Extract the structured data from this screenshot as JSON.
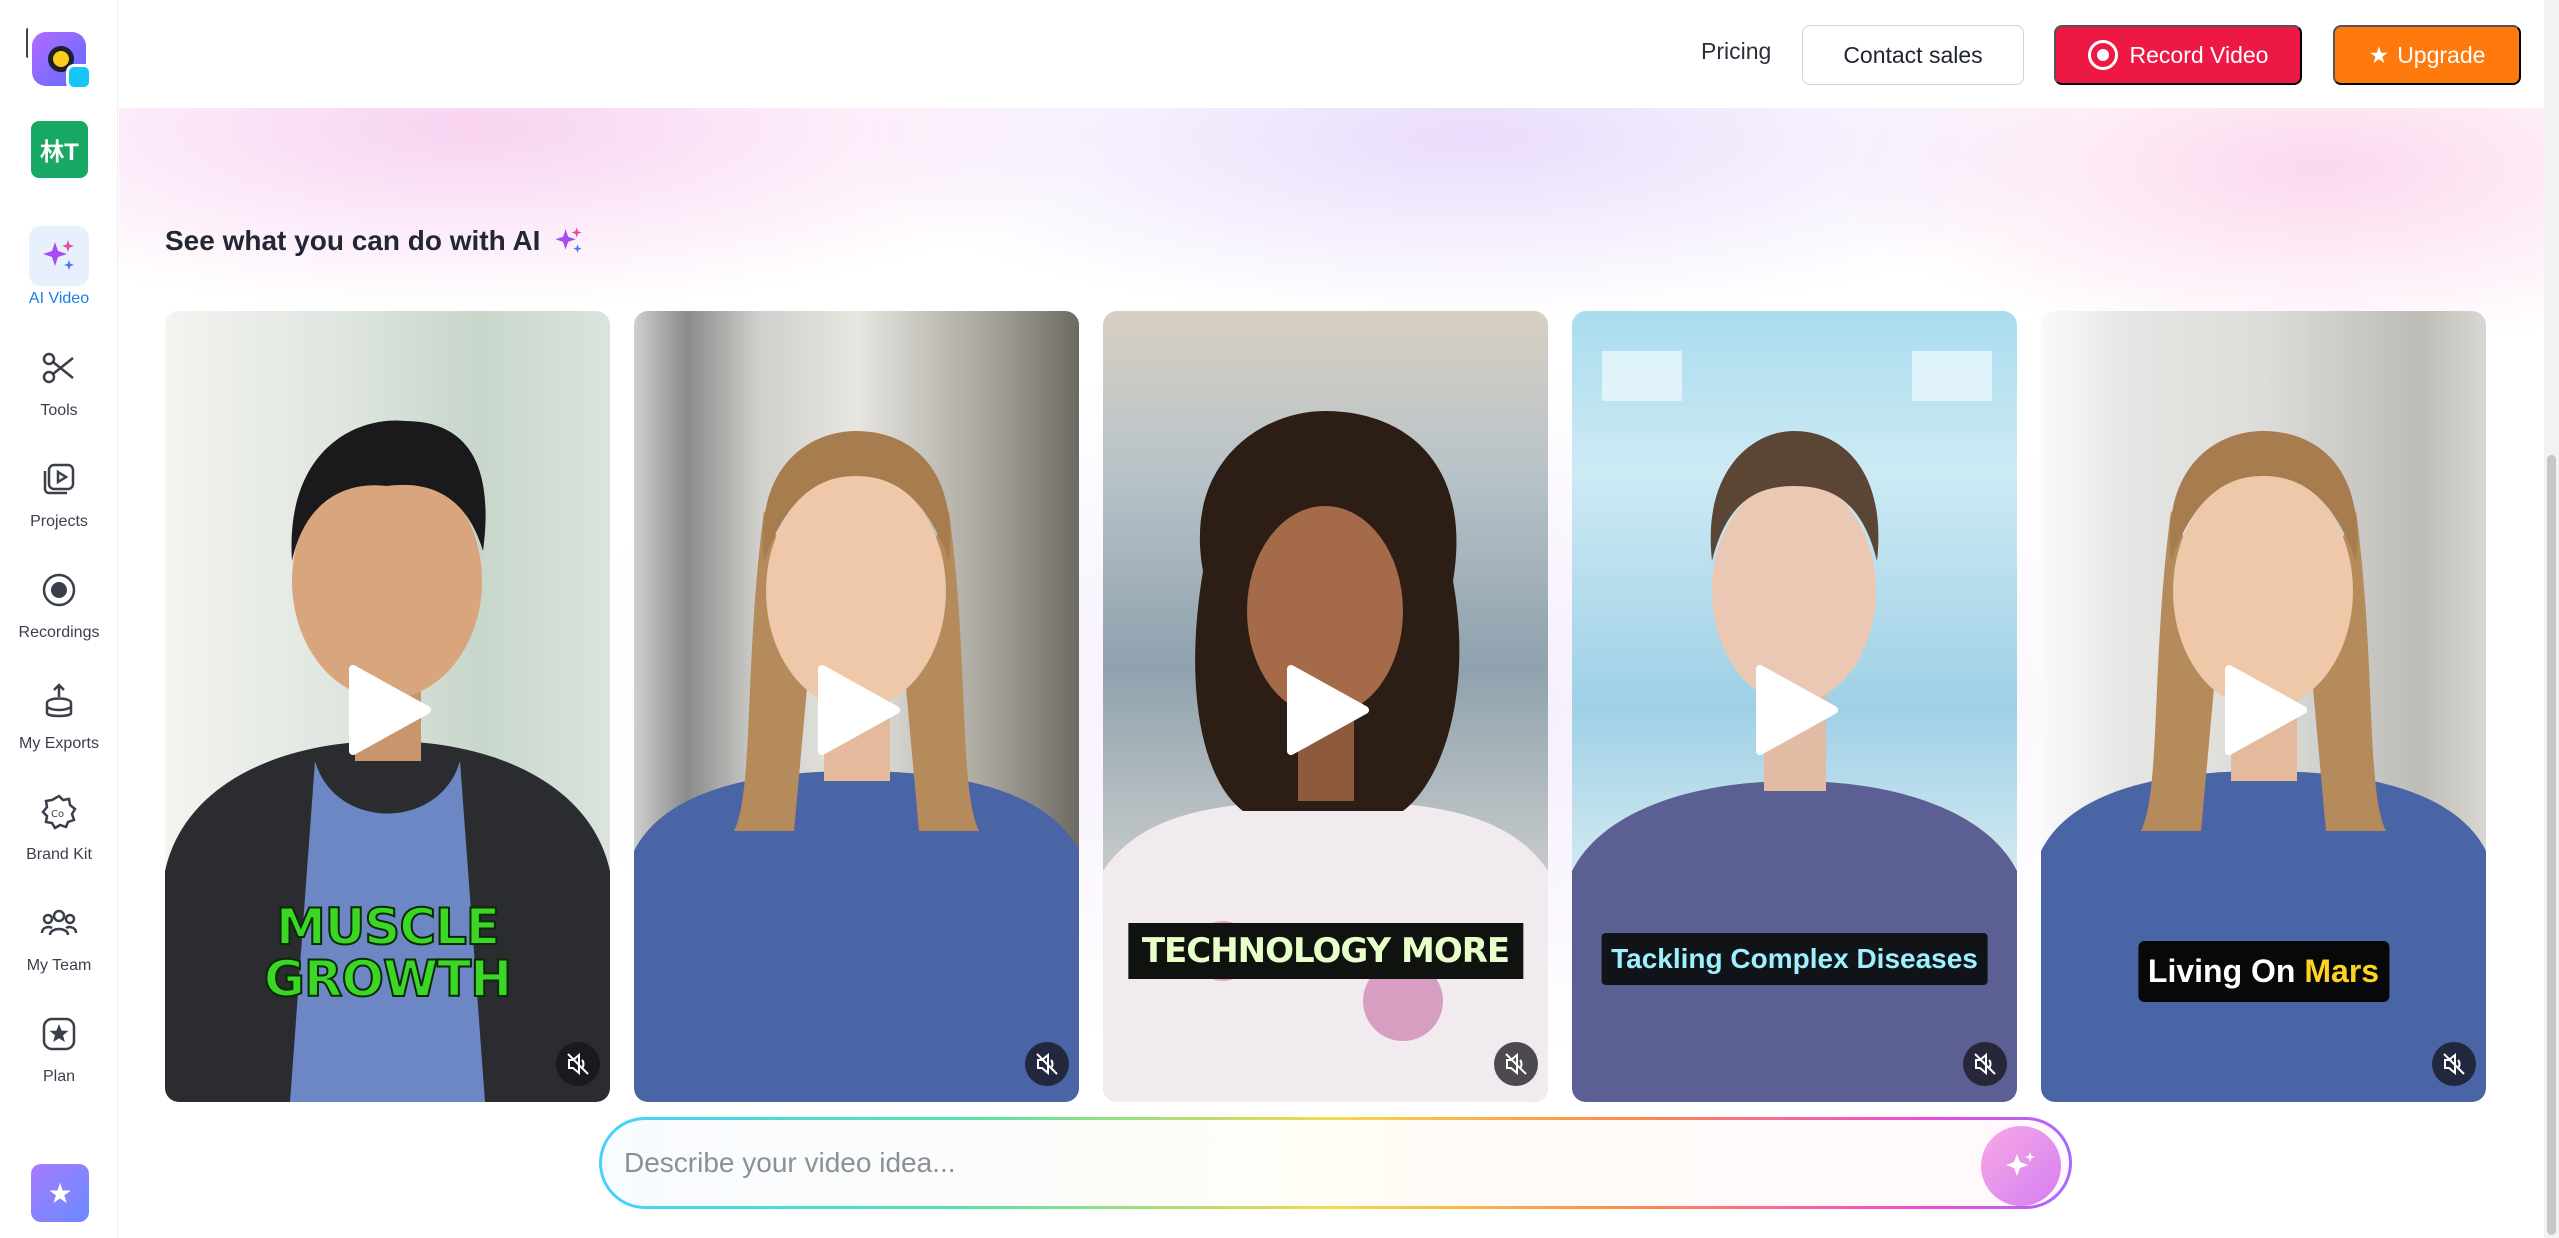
{
  "sidebar": {
    "workspace_initials": "林T",
    "items": [
      {
        "label": "AI Video",
        "active": true
      },
      {
        "label": "Tools"
      },
      {
        "label": "Projects"
      },
      {
        "label": "Recordings"
      },
      {
        "label": "My Exports"
      },
      {
        "label": "Brand Kit"
      },
      {
        "label": "My Team"
      },
      {
        "label": "Plan"
      }
    ]
  },
  "header": {
    "pricing_label": "Pricing",
    "contact_label": "Contact sales",
    "record_label": "Record Video",
    "upgrade_label": "Upgrade",
    "upgrade_icon": "★"
  },
  "main": {
    "section_title": "See what you can do with AI",
    "cards": [
      {
        "caption_line1": "MUSCLE",
        "caption_line2": "GROWTH"
      },
      {
        "caption": ""
      },
      {
        "caption": "TECHNOLOGY MORE"
      },
      {
        "caption": "Tackling Complex Diseases"
      },
      {
        "caption_part1": "Living On ",
        "caption_highlight": "Mars"
      }
    ]
  },
  "prompt": {
    "placeholder": "Describe your video idea..."
  },
  "colors": {
    "record": "#ee1844",
    "upgrade": "#ff7a0d",
    "avatar": "#8b4dff",
    "active_nav": "#1c7ee6"
  }
}
